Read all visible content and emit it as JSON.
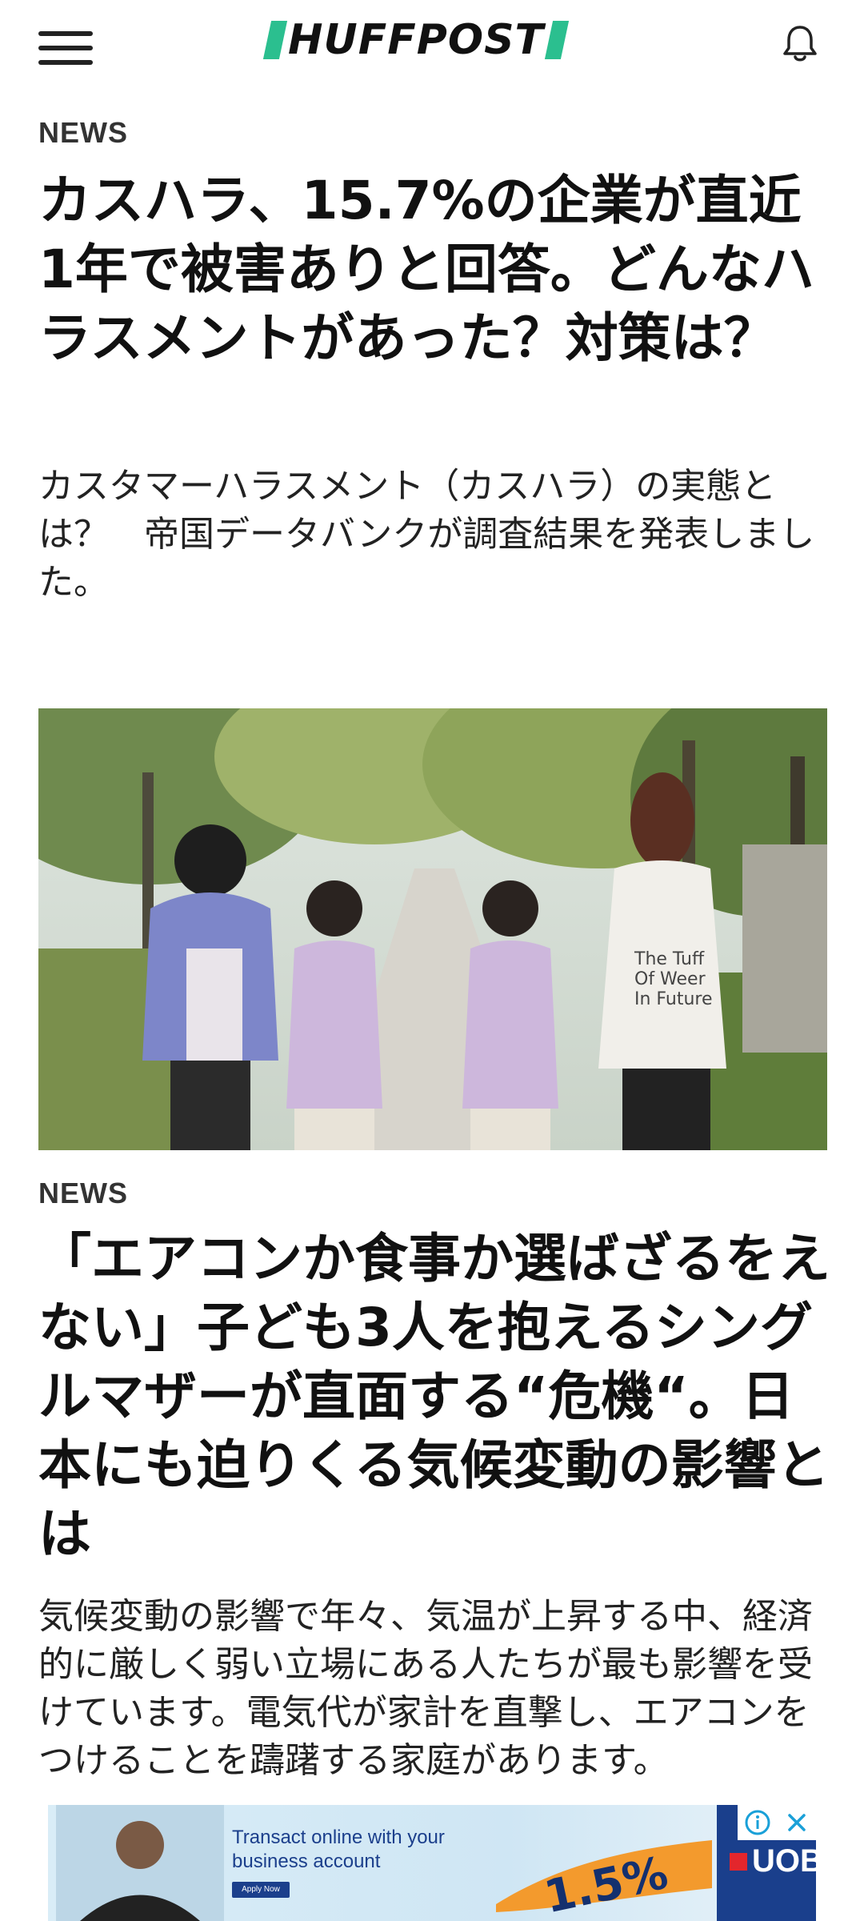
{
  "header": {
    "logo_text": "HUFFPOST",
    "menu_icon": "hamburger-menu-icon",
    "notification_icon": "bell-icon",
    "brand_accent_color": "#2bbf8f"
  },
  "articles": [
    {
      "section": "NEWS",
      "headline": "カスハラ、15.7%の企業が直近1年で被害ありと回答。どんなハラスメントがあった？対策は？",
      "summary": "カスタマーハラスメント（カスハラ）の実態とは？　帝国データバンクが調査結果を発表しました。"
    },
    {
      "section": "NEWS",
      "headline": "「エアコンか食事か選ばざるをえない」子ども3人を抱えるシングルマザーが直面する“危機“。日本にも迫りくる気候変動の影響とは",
      "summary": "気候変動の影響で年々、気温が上昇する中、経済的に厳しく弱い立場にある人たちが最も影響を受けています。電気代が家計を直撃し、エアコンをつけることを躊躇する家庭があります。"
    }
  ],
  "ad": {
    "tagline": "Transact online with your business account",
    "button_label": "Apply Now",
    "rate": "1.5%",
    "brand": "UOB",
    "info_icon": "info-icon",
    "close_icon": "close-icon"
  }
}
